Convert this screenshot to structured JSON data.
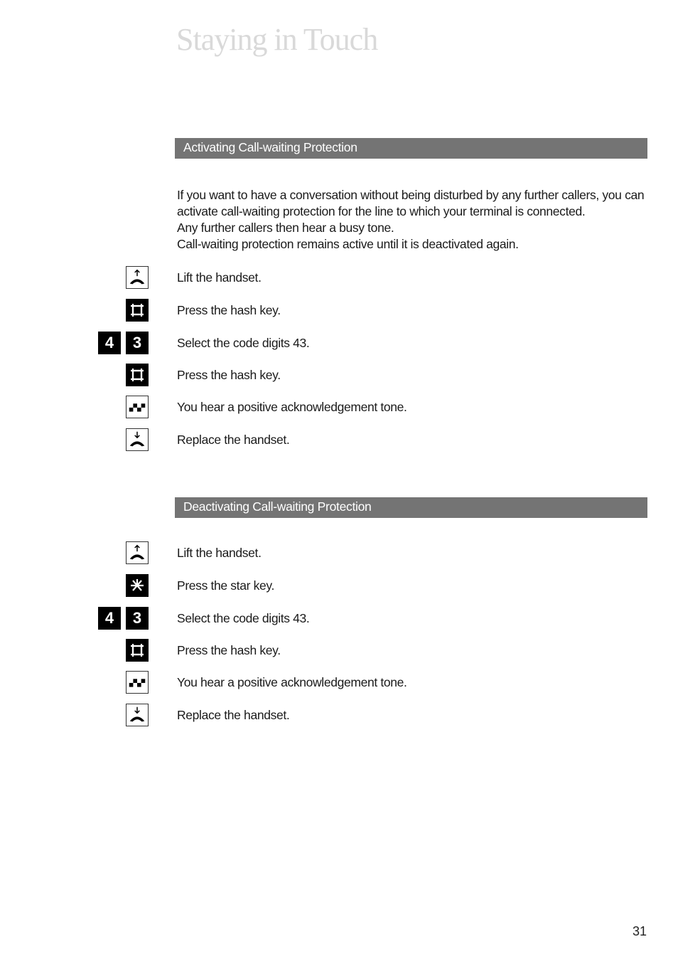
{
  "page": {
    "title": "Staying in Touch",
    "page_number": "31"
  },
  "sections": [
    {
      "heading": "Activating Call-waiting Protection",
      "intro": [
        "If you want to have a conversation without being disturbed by any further callers, you can activate call-waiting protection for the line to which your terminal is connected.",
        "Any further callers then hear a busy tone.",
        "Call-waiting protection remains active until it is deactivated again."
      ],
      "steps": [
        {
          "icon": "lift-handset-icon",
          "text": "Lift the handset."
        },
        {
          "icon": "hash-key-icon",
          "text": "Press the hash key."
        },
        {
          "icon": "digit-keys",
          "digits": [
            "4",
            "3"
          ],
          "text": "Select the code digits 43."
        },
        {
          "icon": "hash-key-icon",
          "text": "Press the hash key."
        },
        {
          "icon": "acknowledgement-tone-icon",
          "text": "You hear a positive acknowledgement tone."
        },
        {
          "icon": "replace-handset-icon",
          "text": "Replace the handset."
        }
      ]
    },
    {
      "heading": "Deactivating Call-waiting Protection",
      "steps": [
        {
          "icon": "lift-handset-icon",
          "text": "Lift the handset."
        },
        {
          "icon": "star-key-icon",
          "text": "Press the star key."
        },
        {
          "icon": "digit-keys",
          "digits": [
            "4",
            "3"
          ],
          "text": "Select the code digits 43."
        },
        {
          "icon": "hash-key-icon",
          "text": "Press the hash key."
        },
        {
          "icon": "acknowledgement-tone-icon",
          "text": "You hear a positive acknowledgement tone."
        },
        {
          "icon": "replace-handset-icon",
          "text": "Replace the handset."
        }
      ]
    }
  ]
}
